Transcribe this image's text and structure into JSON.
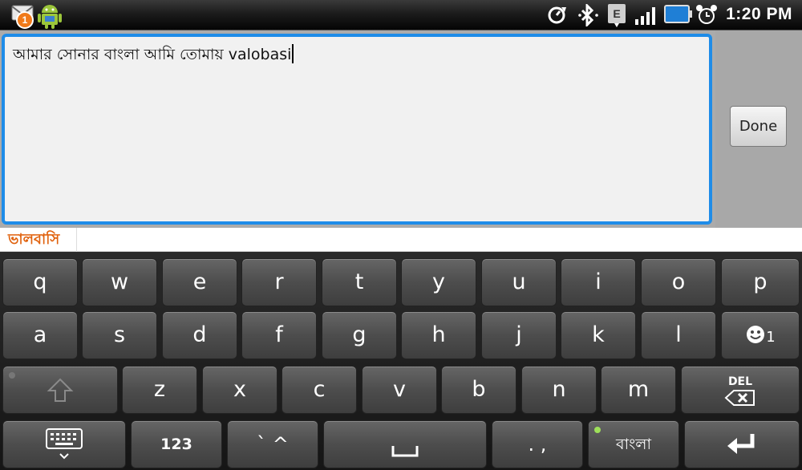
{
  "status_bar": {
    "notification_count": "1",
    "time": "1:20 PM",
    "icons": [
      "mail-icon",
      "android-icon",
      "sync-icon",
      "bluetooth-icon",
      "edge-data-icon",
      "signal-icon",
      "battery-icon",
      "alarm-icon"
    ]
  },
  "editor": {
    "text": "আমার সোনার বাংলা আমি তোমায় valobasi",
    "done_label": "Done"
  },
  "suggestions": [
    "ভালবাসি"
  ],
  "keyboard": {
    "row1": [
      "q",
      "w",
      "e",
      "r",
      "t",
      "y",
      "u",
      "i",
      "o",
      "p"
    ],
    "row2": [
      "a",
      "s",
      "d",
      "f",
      "g",
      "h",
      "j",
      "k",
      "l"
    ],
    "emoji_key_hint": "1",
    "row3": [
      "z",
      "x",
      "c",
      "v",
      "b",
      "n",
      "m"
    ],
    "del_label": "DEL",
    "numbers_label": "123",
    "accent_label": "` ^",
    "punct_label": ". ,",
    "language_label": "বাংলা"
  },
  "colors": {
    "focus_border": "#1e8ce8",
    "suggestion_text": "#e0620e",
    "language_indicator": "#9ee05a"
  }
}
